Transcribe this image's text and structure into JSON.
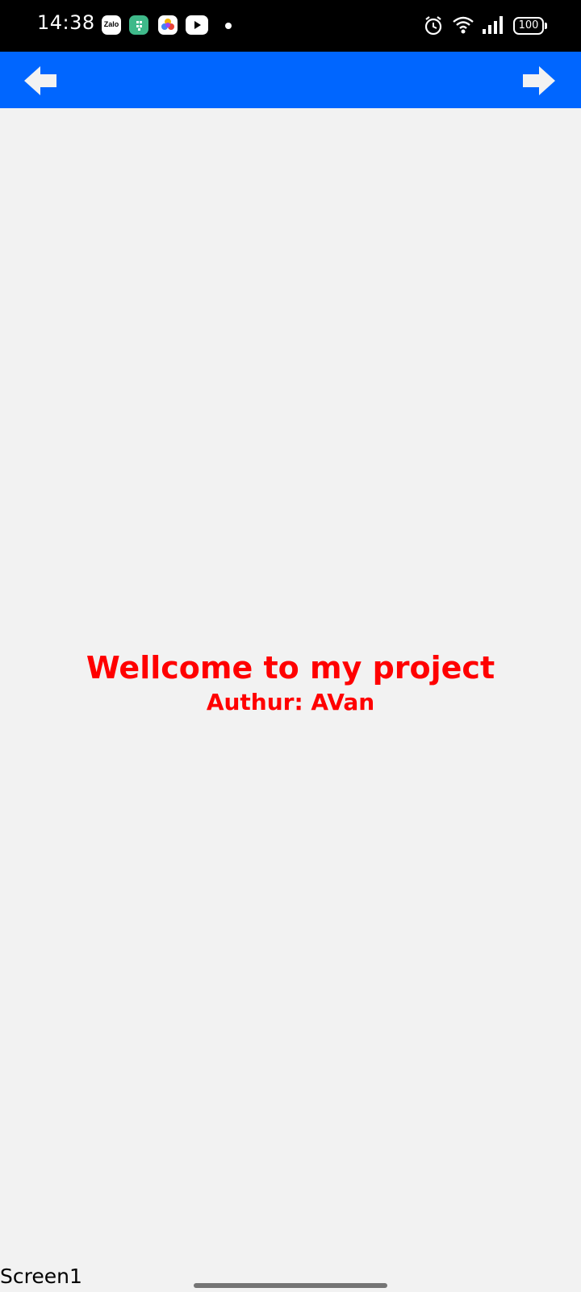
{
  "status_bar": {
    "time": "14:38",
    "zalo_label": "Zalo",
    "battery": "100",
    "icons": [
      "zalo-icon",
      "green-app-icon",
      "photos-icon",
      "youtube-icon",
      "notification-dot",
      "alarm-icon",
      "wifi-icon",
      "signal-icon",
      "battery-icon"
    ]
  },
  "toolbar": {
    "color": "#0066ff",
    "back_icon": "arrow-left-icon",
    "forward_icon": "arrow-right-icon"
  },
  "content": {
    "title": "Wellcome to my project",
    "author": "Authur: AVan",
    "text_color": "#ff0000",
    "background": "#f2f2f2"
  },
  "footer": {
    "screen_name": "Screen1"
  }
}
